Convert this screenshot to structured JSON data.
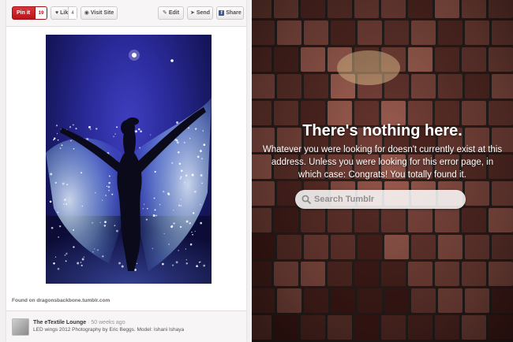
{
  "pinterest": {
    "toolbar": {
      "pinit_label": "Pin it",
      "pinit_count": "19",
      "like_label": "Like",
      "like_count": "4",
      "visit_label": "Visit Site",
      "edit_label": "Edit",
      "send_label": "Send",
      "share_label": "Share"
    },
    "found_on": "Found on dragonsbackbone.tumblr.com",
    "attribution": {
      "source_name": "The eTextile Lounge",
      "time": "· 50 weeks ago",
      "caption": "LED wings 2012 Photography by Eric Beggs. Model: Ishani Ishaya"
    },
    "colors": {
      "pinit_red": "#c4202a",
      "facebook_blue": "#3b5998"
    }
  },
  "tumblr": {
    "title": "There's nothing here.",
    "message": "Whatever you were looking for doesn't currently exist at this address. Unless you were looking for this error page, in which case: Congrats! You totally found it.",
    "search": {
      "placeholder": "Search Tumblr"
    }
  }
}
